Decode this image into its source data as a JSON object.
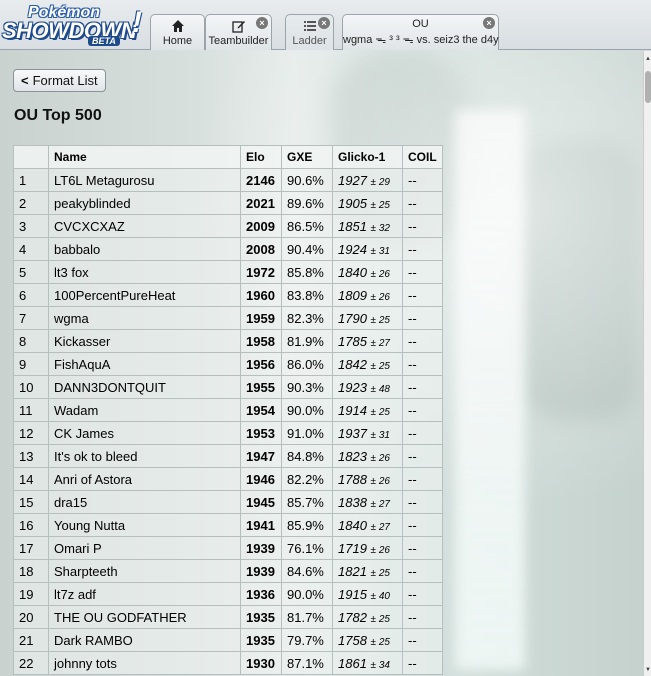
{
  "logo": {
    "line1": "Pokémon",
    "line2": "SHOWDOWN",
    "line3": "BETA",
    "bang": "!"
  },
  "tabs": {
    "home": {
      "label": "Home",
      "icon": "home-icon"
    },
    "teambuilder": {
      "label": "Teambuilder",
      "icon": "edit-icon"
    },
    "ladder": {
      "label": "Ladder",
      "icon": "list-icon"
    },
    "battle": {
      "format": "OU",
      "players": "wgma ᯓ ³ ³ ᯓ vs. seiz3 the d4y"
    }
  },
  "format_button": {
    "label": "Format List"
  },
  "page_title": "OU Top 500",
  "columns": [
    "",
    "Name",
    "Elo",
    "GXE",
    "Glicko-1",
    "COIL"
  ],
  "rows": [
    {
      "rank": "1",
      "name": "LT6L Metagurosu",
      "elo": "2146",
      "gxe": "90.6%",
      "glicko": "1927",
      "dev": "± 29",
      "coil": "--"
    },
    {
      "rank": "2",
      "name": "peakyblinded",
      "elo": "2021",
      "gxe": "89.6%",
      "glicko": "1905",
      "dev": "± 25",
      "coil": "--"
    },
    {
      "rank": "3",
      "name": "CVCXCXAZ",
      "elo": "2009",
      "gxe": "86.5%",
      "glicko": "1851",
      "dev": "± 32",
      "coil": "--"
    },
    {
      "rank": "4",
      "name": "babbalo",
      "elo": "2008",
      "gxe": "90.4%",
      "glicko": "1924",
      "dev": "± 31",
      "coil": "--"
    },
    {
      "rank": "5",
      "name": "lt3 fox",
      "elo": "1972",
      "gxe": "85.8%",
      "glicko": "1840",
      "dev": "± 26",
      "coil": "--"
    },
    {
      "rank": "6",
      "name": "100PercentPureHeat",
      "elo": "1960",
      "gxe": "83.8%",
      "glicko": "1809",
      "dev": "± 26",
      "coil": "--"
    },
    {
      "rank": "7",
      "name": "wgma",
      "elo": "1959",
      "gxe": "82.3%",
      "glicko": "1790",
      "dev": "± 25",
      "coil": "--"
    },
    {
      "rank": "8",
      "name": "Kickasser",
      "elo": "1958",
      "gxe": "81.9%",
      "glicko": "1785",
      "dev": "± 27",
      "coil": "--"
    },
    {
      "rank": "9",
      "name": "FishAquA",
      "elo": "1956",
      "gxe": "86.0%",
      "glicko": "1842",
      "dev": "± 25",
      "coil": "--"
    },
    {
      "rank": "10",
      "name": "DANN3DONTQUIT",
      "elo": "1955",
      "gxe": "90.3%",
      "glicko": "1923",
      "dev": "± 48",
      "coil": "--"
    },
    {
      "rank": "11",
      "name": "Wadam",
      "elo": "1954",
      "gxe": "90.0%",
      "glicko": "1914",
      "dev": "± 25",
      "coil": "--"
    },
    {
      "rank": "12",
      "name": "CK James",
      "elo": "1953",
      "gxe": "91.0%",
      "glicko": "1937",
      "dev": "± 31",
      "coil": "--"
    },
    {
      "rank": "13",
      "name": "It's ok to bleed",
      "elo": "1947",
      "gxe": "84.8%",
      "glicko": "1823",
      "dev": "± 26",
      "coil": "--"
    },
    {
      "rank": "14",
      "name": "Anri of Astora",
      "elo": "1946",
      "gxe": "82.2%",
      "glicko": "1788",
      "dev": "± 26",
      "coil": "--"
    },
    {
      "rank": "15",
      "name": "dra15",
      "elo": "1945",
      "gxe": "85.7%",
      "glicko": "1838",
      "dev": "± 27",
      "coil": "--"
    },
    {
      "rank": "16",
      "name": "Young Nutta",
      "elo": "1941",
      "gxe": "85.9%",
      "glicko": "1840",
      "dev": "± 27",
      "coil": "--"
    },
    {
      "rank": "17",
      "name": "Omari P",
      "elo": "1939",
      "gxe": "76.1%",
      "glicko": "1719",
      "dev": "± 26",
      "coil": "--"
    },
    {
      "rank": "18",
      "name": "Sharpteeth",
      "elo": "1939",
      "gxe": "84.6%",
      "glicko": "1821",
      "dev": "± 25",
      "coil": "--"
    },
    {
      "rank": "19",
      "name": "lt7z adf",
      "elo": "1936",
      "gxe": "90.0%",
      "glicko": "1915",
      "dev": "± 40",
      "coil": "--"
    },
    {
      "rank": "20",
      "name": "THE OU GODFATHER",
      "elo": "1935",
      "gxe": "81.7%",
      "glicko": "1782",
      "dev": "± 25",
      "coil": "--"
    },
    {
      "rank": "21",
      "name": "Dark RAMBO",
      "elo": "1935",
      "gxe": "79.7%",
      "glicko": "1758",
      "dev": "± 25",
      "coil": "--"
    },
    {
      "rank": "22",
      "name": "johnny tots",
      "elo": "1930",
      "gxe": "87.1%",
      "glicko": "1861",
      "dev": "± 34",
      "coil": "--"
    }
  ]
}
